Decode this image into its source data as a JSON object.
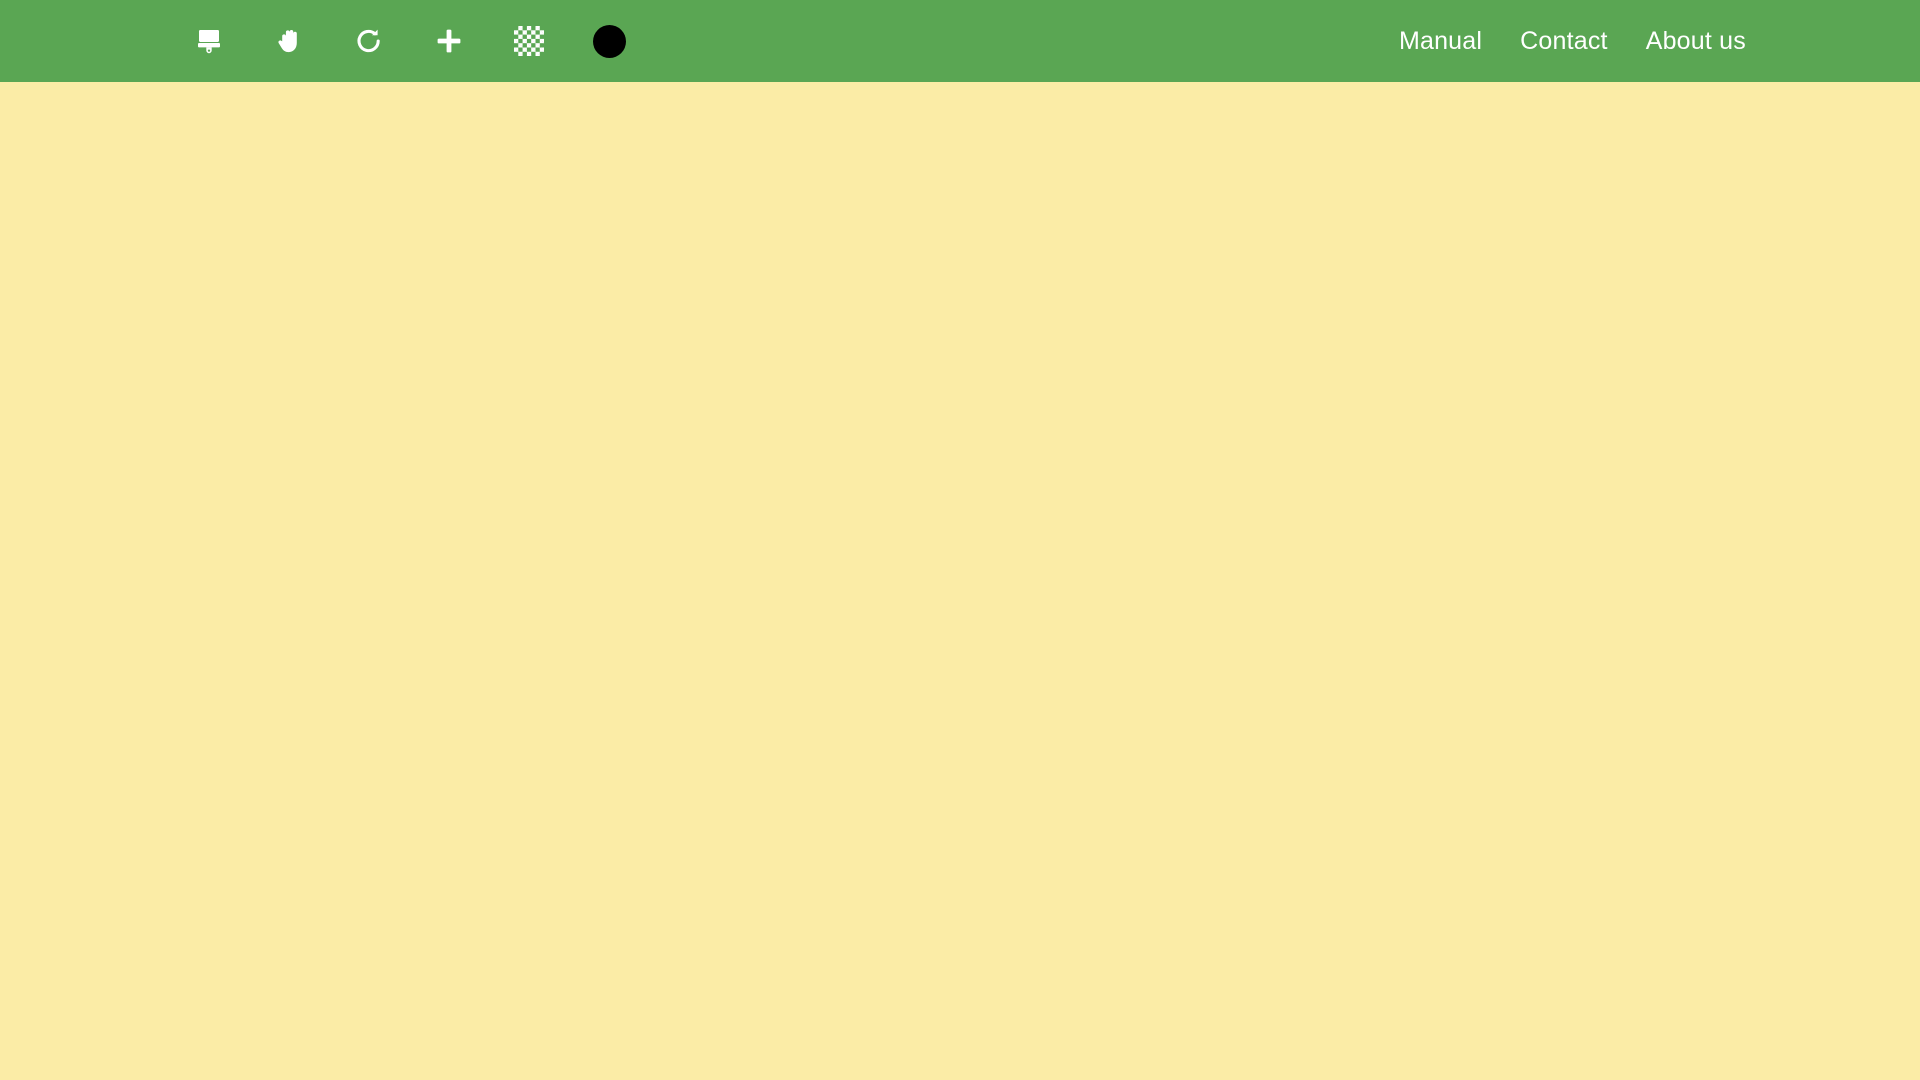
{
  "theme": {
    "header_bg": "#5aa653",
    "canvas_bg": "#fbeca6",
    "icon_color": "#ffffff",
    "nav_text_color": "#ffffff",
    "swatch_color": "#000000"
  },
  "header": {
    "toolbar": {
      "tools": [
        {
          "id": "brush",
          "icon": "paint-brush-icon",
          "label": "Brush"
        },
        {
          "id": "hand",
          "icon": "hand-icon",
          "label": "Hand"
        },
        {
          "id": "redo",
          "icon": "redo-icon",
          "label": "Redo"
        },
        {
          "id": "add",
          "icon": "plus-icon",
          "label": "Add"
        },
        {
          "id": "pattern",
          "icon": "checkerboard-icon",
          "label": "Pattern"
        },
        {
          "id": "color",
          "icon": "color-swatch-icon",
          "label": "Color",
          "value": "#000000"
        }
      ]
    },
    "nav": {
      "links": [
        {
          "label": "Manual"
        },
        {
          "label": "Contact"
        },
        {
          "label": "About us"
        }
      ]
    }
  },
  "canvas": {
    "content": ""
  }
}
